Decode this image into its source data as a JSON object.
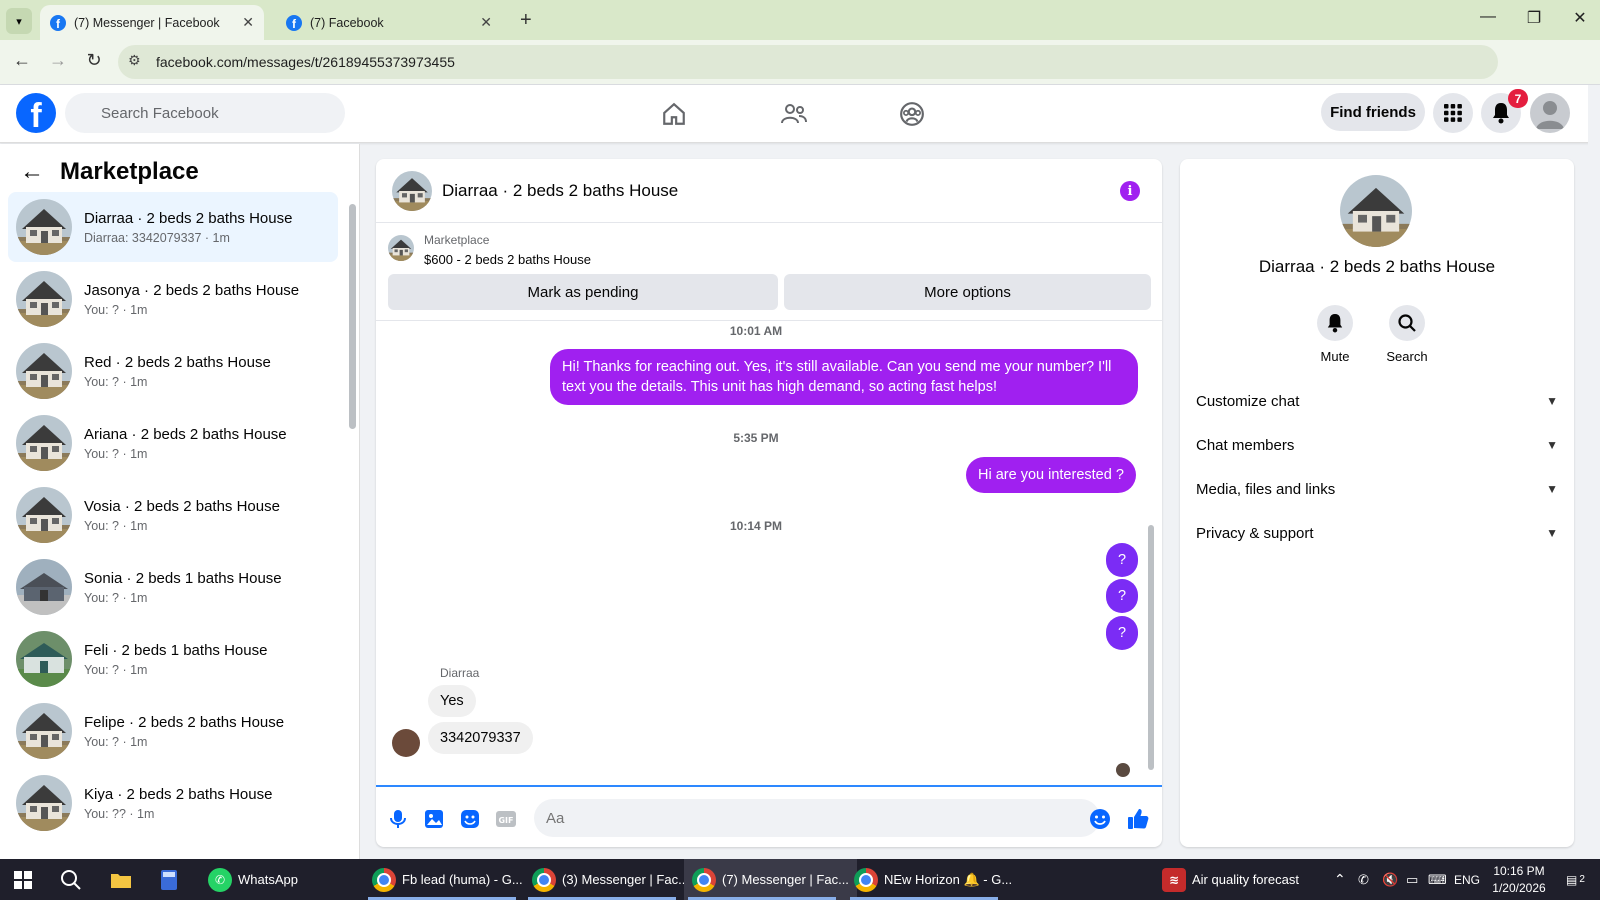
{
  "browser": {
    "tabs": [
      {
        "title": "(7) Messenger | Facebook",
        "active": true
      },
      {
        "title": "(7) Facebook",
        "active": false
      }
    ],
    "url": "facebook.com/messages/t/26189455373973455"
  },
  "header": {
    "search_placeholder": "Search Facebook",
    "find_friends": "Find friends",
    "notification_count": "7"
  },
  "sidebar": {
    "title": "Marketplace",
    "conversations": [
      {
        "name": "Diarraa · 2 beds 2 baths House",
        "preview": "Diarraa: 3342079337 · 1m"
      },
      {
        "name": "Jasonya · 2 beds 2 baths House",
        "preview": "You: ? · 1m"
      },
      {
        "name": "Red · 2 beds 2 baths House",
        "preview": "You: ? · 1m"
      },
      {
        "name": "Ariana · 2 beds 2 baths House",
        "preview": "You: ? · 1m"
      },
      {
        "name": "Vosia · 2 beds 2 baths House",
        "preview": "You: ? · 1m"
      },
      {
        "name": "Sonia · 2 beds 1 baths House",
        "preview": "You: ? · 1m"
      },
      {
        "name": "Feli · 2 beds 1 baths House",
        "preview": "You: ? · 1m"
      },
      {
        "name": "Felipe · 2 beds 2 baths House",
        "preview": "You: ? · 1m"
      },
      {
        "name": "Kiya · 2 beds 2 baths House",
        "preview": "You: ?? · 1m"
      }
    ]
  },
  "chat": {
    "title": "Diarraa · 2 beds 2 baths House",
    "marketplace_label": "Marketplace",
    "listing": "$600 - 2 beds 2 baths House",
    "mark_pending": "Mark as pending",
    "more_options": "More options",
    "timestamps": [
      "10:01 AM",
      "5:35 PM",
      "10:14 PM"
    ],
    "outgoing": [
      "Hi! Thanks for reaching out. Yes, it's still available. Can you send me your number? I'll text you the details. This unit has high demand, so acting fast helps!",
      "Hi are you interested ?",
      "?",
      "?",
      "?"
    ],
    "sender_name": "Diarraa",
    "incoming": [
      "Yes",
      "3342079337"
    ],
    "composer_placeholder": "Aa"
  },
  "info_panel": {
    "name": "Diarraa · 2 beds 2 baths House",
    "mute": "Mute",
    "search": "Search",
    "sections": [
      "Customize chat",
      "Chat members",
      "Media, files and links",
      "Privacy & support"
    ]
  },
  "taskbar": {
    "apps": [
      {
        "label": "WhatsApp"
      },
      {
        "label": "Fb lead (huma) - G..."
      },
      {
        "label": "(3) Messenger | Fac..."
      },
      {
        "label": "(7) Messenger | Fac..."
      },
      {
        "label": "NEw Horizon 🔔 - G..."
      }
    ],
    "weather": "Air quality forecast",
    "lang": "ENG",
    "time": "10:16 PM",
    "date": "1/20/2026",
    "notif": "2"
  }
}
